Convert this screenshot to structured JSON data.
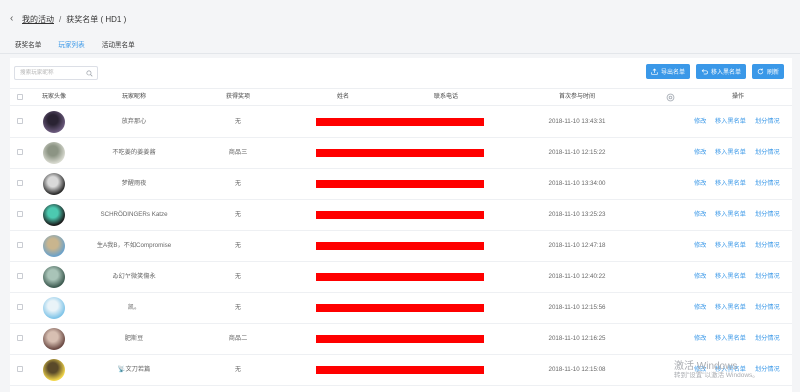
{
  "breadcrumb": {
    "back_icon": "chevron-left-icon",
    "parent": "我的活动",
    "separator": "/",
    "current": "获奖名单 ( HD1 )"
  },
  "tabs": [
    {
      "label": "获奖名单",
      "active": false
    },
    {
      "label": "玩家列表",
      "active": true
    },
    {
      "label": "活动黑名单",
      "active": false
    }
  ],
  "search": {
    "placeholder": "搜索玩家昵称",
    "icon": "search-icon"
  },
  "toolbar": {
    "export_label": "导出名单",
    "blacklist_label": "移入黑名单",
    "refresh_label": "刷新"
  },
  "table": {
    "columns": [
      "玩家头像",
      "玩家昵称",
      "获得奖项",
      "姓名",
      "联系电话",
      "首次参与时间",
      "操作"
    ],
    "settings_icon": "gear-icon",
    "action_labels": [
      "修改",
      "移入黑名单",
      "划分情况"
    ],
    "rows": [
      {
        "nickname": "放弃那心",
        "prize": "无",
        "time": "2018-11-10 13:43:31",
        "avatar_colors": [
          "#6b5a7d",
          "#2a2333"
        ]
      },
      {
        "nickname": "不吃姜的姜姜酱",
        "prize": "商品三",
        "time": "2018-11-10 12:15:22",
        "avatar_colors": [
          "#d7d9cf",
          "#8c9484"
        ]
      },
      {
        "nickname": "梦醒雨夜",
        "prize": "无",
        "time": "2018-11-10 13:34:00",
        "avatar_colors": [
          "#2b2b2b",
          "#d9d9d9"
        ]
      },
      {
        "nickname": "SCHRÖDINGERs Katze",
        "prize": "无",
        "time": "2018-11-10 13:25:23",
        "avatar_colors": [
          "#1a1a1a",
          "#4cc9b0"
        ]
      },
      {
        "nickname": "生A我B，不如Compromise",
        "prize": "无",
        "time": "2018-11-10 12:47:18",
        "avatar_colors": [
          "#6ba1c9",
          "#c9b58e"
        ]
      },
      {
        "nickname": "ゐ幻ヤ微笑傷永",
        "prize": "无",
        "time": "2018-11-10 12:40:22",
        "avatar_colors": [
          "#3d5a50",
          "#a9c4b8"
        ]
      },
      {
        "nickname": "凯。",
        "prize": "无",
        "time": "2018-11-10 12:15:56",
        "avatar_colors": [
          "#7fc4e8",
          "#e9f3f8"
        ]
      },
      {
        "nickname": "肥斯豆",
        "prize": "商品二",
        "time": "2018-11-10 12:16:25",
        "avatar_colors": [
          "#6b4a44",
          "#d7bfb2"
        ]
      },
      {
        "nickname": "📡文刀若篇",
        "prize": "无",
        "time": "2018-11-10 12:15:08",
        "avatar_colors": [
          "#f2d64b",
          "#5a4a2a"
        ]
      }
    ]
  },
  "watermark": {
    "line1": "激活 Windows",
    "line2": "转到\"设置\"以激活 Windows。"
  },
  "colors": {
    "accent": "#3a98e8",
    "redaction": "#ff0000"
  }
}
